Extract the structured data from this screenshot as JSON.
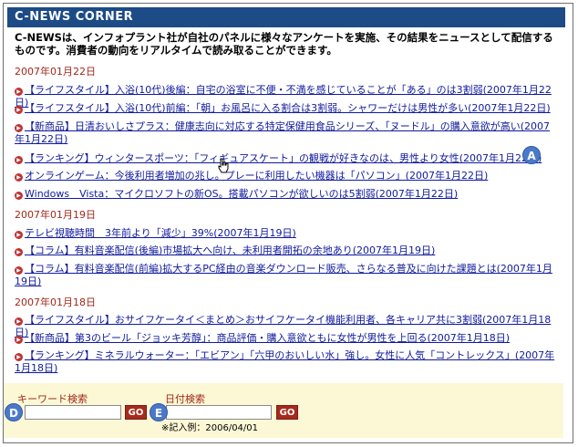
{
  "header": {
    "title": "C-NEWS CORNER"
  },
  "intro": "C-NEWSは、インフォプラント社が自社のパネルに様々なアンケートを実施、その結果をニュースとして配信するものです。消費者の動向をリアルタイムで読み取ることができます。",
  "sections": [
    {
      "date": "2007年01月22日",
      "items": [
        "【ライフスタイル】入浴(10代)後編：自宅の浴室に不便・不満を感じていることが「ある」のは3割弱(2007年1月22日)",
        "【ライフスタイル】入浴(10代)前編：「朝」お風呂に入る割合は3割弱。シャワーだけは男性が多い(2007年1月22日)",
        "【新商品】日清おいしさプラス：健康志向に対応する特定保健用食品シリーズ、「ヌードル」の購入意欲が高い(2007年1月22日)",
        "【ランキング】ウィンタースポーツ：「フィギュアスケート」の観戦が好きなのは、男性より女性(2007年1月22日)",
        "オンラインゲーム：今後利用者増加の兆し。プレーに利用したい機器は「パソコン」(2007年1月22日)",
        "Windows　Vista：マイクロソフトの新OS。搭載パソコンが欲しいのは5割弱(2007年1月22日)"
      ]
    },
    {
      "date": "2007年01月19日",
      "items": [
        "テレビ視聴時間　3年前より「減少」39%(2007年1月19日)",
        "【コラム】有料音楽配信(後編)市場拡大へ向け、未利用者開拓の余地あり(2007年1月19日)",
        "【コラム】有料音楽配信(前編)拡大するPC経由の音楽ダウンロード販売、さらなる普及に向けた課題とは(2007年1月19日)"
      ]
    },
    {
      "date": "2007年01月18日",
      "items": [
        "【ライフスタイル】おサイフケータイ＜まとめ＞おサイフケータイ機能利用者、各キャリア共に3割弱(2007年1月18日)",
        "【新商品】第3のビール「ジョッキ芳醇」：商品評価・購入意欲ともに女性が男性を上回る(2007年1月18日)",
        "【ランキング】ミネラルウォーター：「エビアン」「六甲のおいしい水」強し。女性に人気「コントレックス」(2007年1月18日)"
      ]
    }
  ],
  "search": {
    "keyword_label": "キーワード検索",
    "keyword_value": "",
    "date_label": "日付検索",
    "date_value": "",
    "go_label": "GO",
    "date_example": "※記入例：2006/04/01"
  },
  "markers": {
    "a": "A",
    "d": "D",
    "e": "E"
  },
  "colors": {
    "header_bg": "#1c4b86",
    "link": "#101a9c",
    "date": "#a0281c",
    "panel_bg": "#fcf8d6",
    "marker": "#4b79c9"
  },
  "icons": {
    "bullet": "red-circle-arrow-icon",
    "cursor": "hand-pointer-icon"
  }
}
